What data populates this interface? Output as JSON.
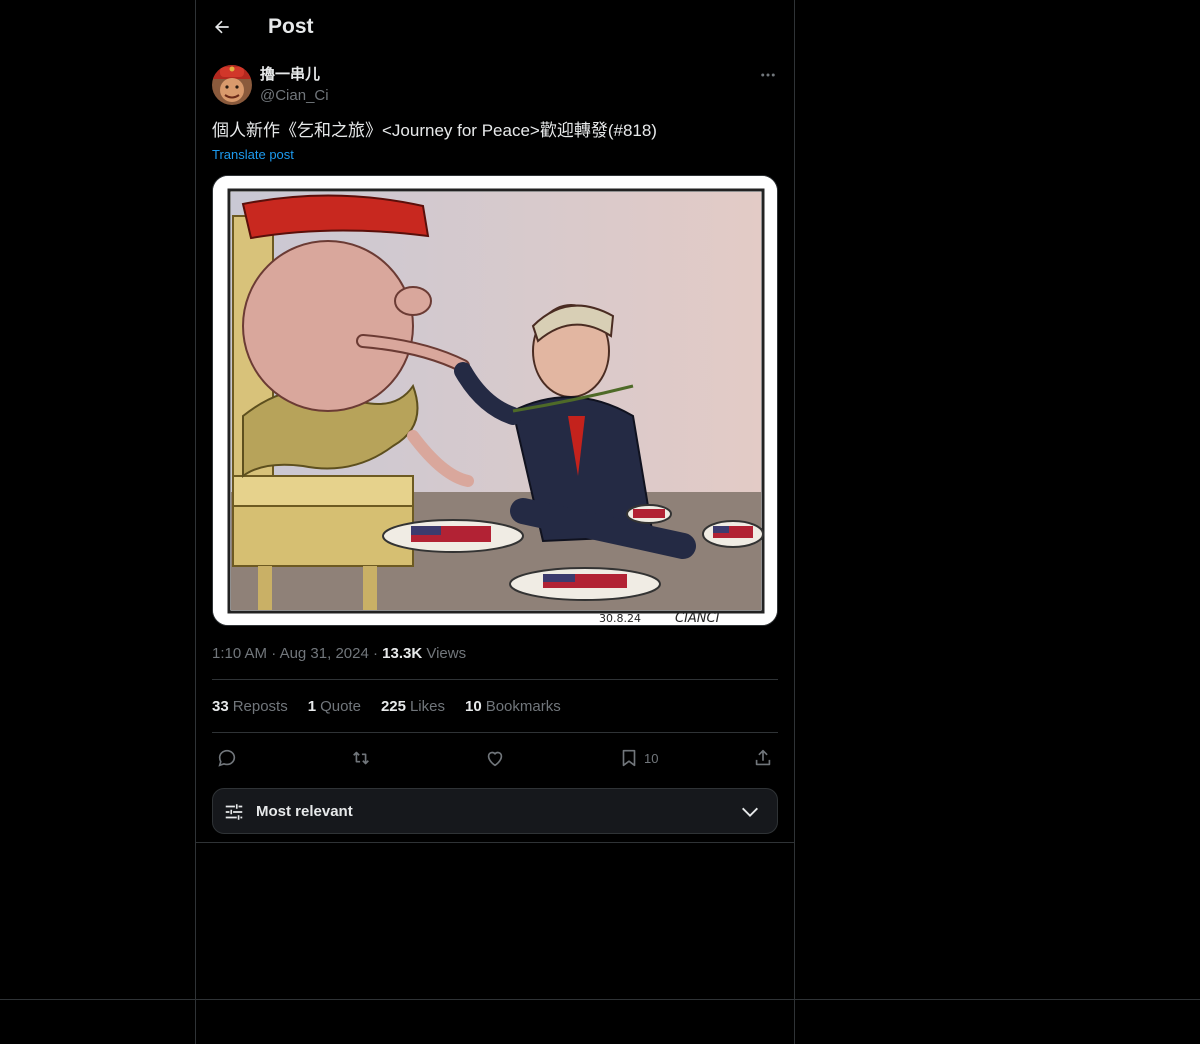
{
  "header": {
    "title": "Post",
    "back_icon": "arrow-left-icon"
  },
  "author": {
    "display_name": "擼一串儿",
    "handle": "@Cian_Ci",
    "avatar_icon": "avatar-image"
  },
  "post": {
    "text": "個人新作《乞和之旅》<Journey for Peace>歡迎轉發(#818)",
    "translate_label": "Translate post",
    "image_signature": "CIANCI",
    "image_date": "30.8.24"
  },
  "meta": {
    "time": "1:10 AM",
    "date": "Aug 31, 2024",
    "views_count": "13.3K",
    "views_label": "Views"
  },
  "stats": {
    "reposts_count": "33",
    "reposts_label": "Reposts",
    "quote_count": "1",
    "quote_label": "Quote",
    "likes_count": "225",
    "likes_label": "Likes",
    "bookmarks_count": "10",
    "bookmarks_label": "Bookmarks"
  },
  "actions": {
    "bookmark_count": "10"
  },
  "sort": {
    "label": "Most relevant"
  },
  "colors": {
    "background": "#000000",
    "text_primary": "#e7e9ea",
    "text_secondary": "#71767b",
    "accent": "#1d9bf0",
    "border": "#2f3336"
  }
}
